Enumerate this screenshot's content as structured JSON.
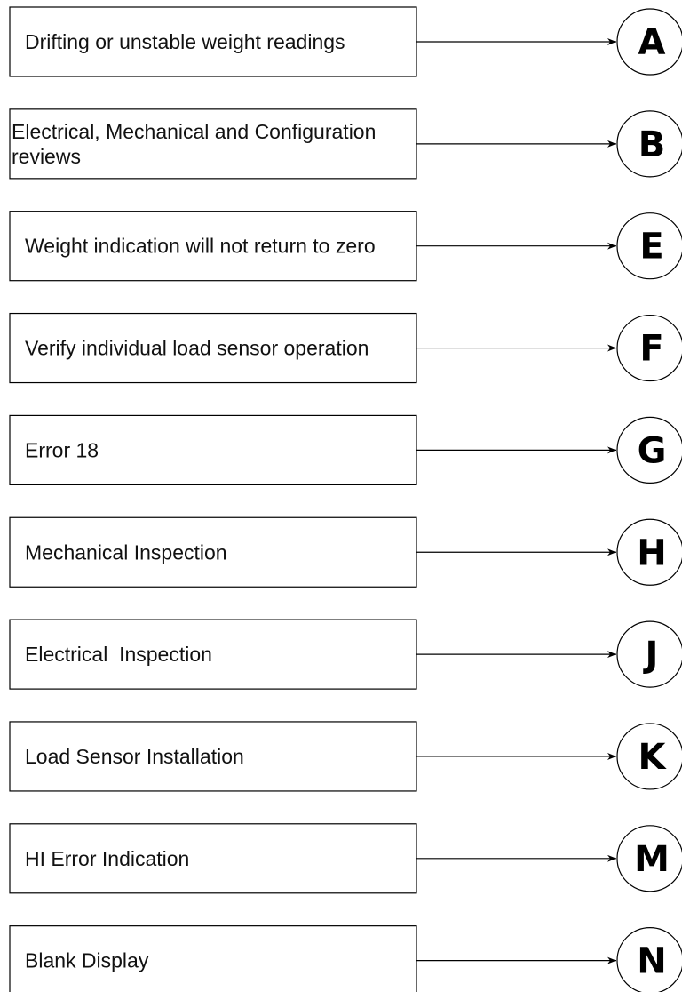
{
  "colors": {
    "stroke": "#000000",
    "text": "#111111",
    "background": "#ffffff"
  },
  "items": [
    {
      "label": [
        "Drifting or unstable weight readings"
      ],
      "letter": "A"
    },
    {
      "label": [
        "Electrical, Mechanical and Configuration",
        "reviews"
      ],
      "letter": "B"
    },
    {
      "label": [
        "Weight indication will not return to zero"
      ],
      "letter": "E"
    },
    {
      "label": [
        "Verify individual load sensor operation"
      ],
      "letter": "F"
    },
    {
      "label": [
        "Error 18"
      ],
      "letter": "G"
    },
    {
      "label": [
        "Mechanical Inspection"
      ],
      "letter": "H"
    },
    {
      "label": [
        "Electrical  Inspection"
      ],
      "letter": "J"
    },
    {
      "label": [
        "Load Sensor Installation"
      ],
      "letter": "K"
    },
    {
      "label": [
        "HI Error Indication"
      ],
      "letter": "M"
    },
    {
      "label": [
        "Blank Display"
      ],
      "letter": "N"
    }
  ]
}
